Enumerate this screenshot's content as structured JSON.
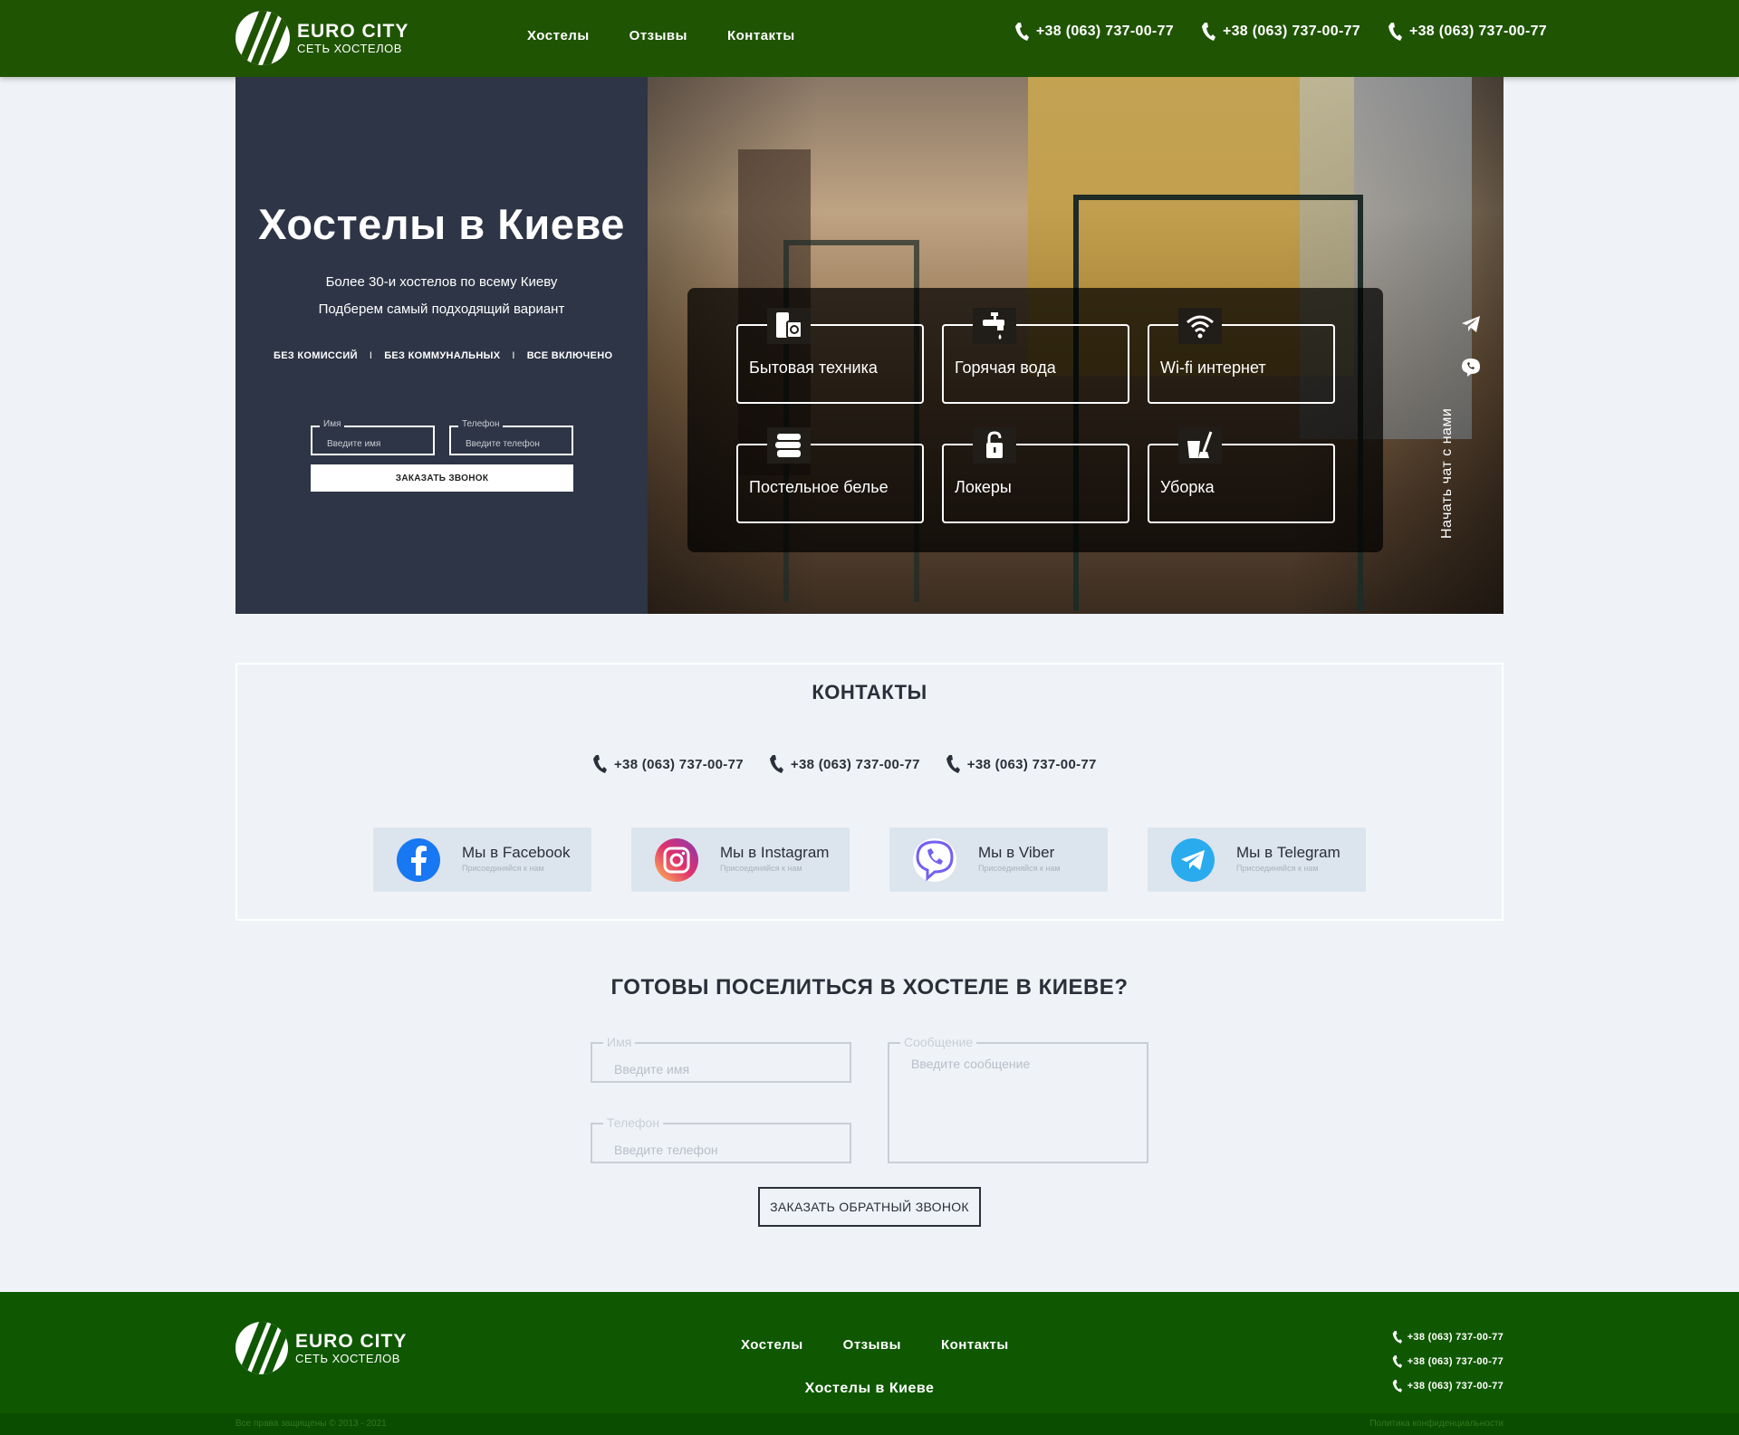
{
  "brand": {
    "title": "EURO CITY",
    "subtitle": "СЕТЬ ХОСТЕЛОВ"
  },
  "nav": [
    {
      "label": "Хостелы"
    },
    {
      "label": "Отзывы"
    },
    {
      "label": "Контакты"
    }
  ],
  "phones": [
    "+38 (063) 737-00-77",
    "+38 (063) 737-00-77",
    "+38 (063) 737-00-77"
  ],
  "hero": {
    "title": "Хостелы в Киеве",
    "line1": "Более 30-и хостелов по всему Киеву",
    "line2": "Подберем самый подходящий вариант",
    "features": [
      "БЕЗ КОМИССИЙ",
      "БЕЗ КОММУНАЛЬНЫХ",
      "ВСЕ ВКЛЮЧЕНО"
    ],
    "separator": "I",
    "name_label": "Имя",
    "name_placeholder": "Введите имя",
    "phone_label": "Телефон",
    "phone_placeholder": "Введите телефон",
    "button": "ЗАКАЗАТЬ ЗВОНОК"
  },
  "amenities": [
    {
      "label": "Бытовая техника",
      "icon": "appliances-icon"
    },
    {
      "label": "Горячая вода",
      "icon": "hot-water-tap-icon"
    },
    {
      "label": "Wi-fi интернет",
      "icon": "wifi-icon"
    },
    {
      "label": "Постельное белье",
      "icon": "bed-linen-icon"
    },
    {
      "label": "Локеры",
      "icon": "lock-icon"
    },
    {
      "label": "Уборка",
      "icon": "cleaning-icon"
    }
  ],
  "side_chat": {
    "label": "Начать чат с нами"
  },
  "contacts": {
    "title": "КОНТАКТЫ",
    "socials": [
      {
        "title": "Мы в Facebook",
        "subtitle": "Присоединяйся к нам",
        "icon": "facebook-icon",
        "color": "#1877f2"
      },
      {
        "title": "Мы в Instagram",
        "subtitle": "Присоединяйся к нам",
        "icon": "instagram-icon",
        "color": "#e1306c"
      },
      {
        "title": "Мы в Viber",
        "subtitle": "Присоединяйся к нам",
        "icon": "viber-icon",
        "color": "#7360f2"
      },
      {
        "title": "Мы в Telegram",
        "subtitle": "Присоединяйся к нам",
        "icon": "telegram-icon",
        "color": "#2aabee"
      }
    ]
  },
  "form": {
    "title": "ГОТОВЫ ПОСЕЛИТЬСЯ В ХОСТЕЛЕ В КИЕВЕ?",
    "name_label": "Имя",
    "name_placeholder": "Введите имя",
    "phone_label": "Телефон",
    "phone_placeholder": "Введите телефон",
    "message_label": "Сообщение",
    "message_placeholder": "Введите сообщение",
    "button": "ЗАКАЗАТЬ ОБРАТНЫЙ ЗВОНОК"
  },
  "footer": {
    "link": "Хостелы в Киеве",
    "copyright": "Все права защищены © 2013 - 2021",
    "privacy": "Политика конфиденциальности"
  },
  "colors": {
    "header_bg": "#1f5403",
    "footer_bg": "#0f5801",
    "hero_panel": "#2d3546",
    "page_bg": "#eff3f7"
  }
}
